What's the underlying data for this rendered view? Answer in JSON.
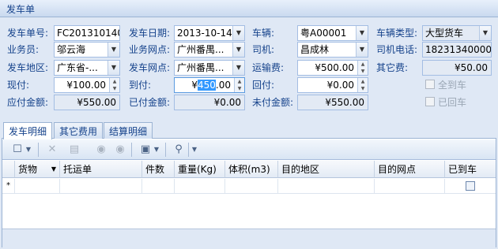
{
  "title": "发车单",
  "form": {
    "dispatch_no": {
      "label": "发车单号:",
      "value": "FC201310140"
    },
    "dispatch_date": {
      "label": "发车日期:",
      "value": "2013-10-14"
    },
    "vehicle": {
      "label": "车辆:",
      "value": "粤A00001"
    },
    "vehicle_type": {
      "label": "车辆类型:",
      "value": "大型货车"
    },
    "salesman": {
      "label": "业务员:",
      "value": "邬云海"
    },
    "dispatch_site": {
      "label": "业务网点:",
      "value": "广州番禺..."
    },
    "driver": {
      "label": "司机:",
      "value": "昌成林"
    },
    "driver_phone": {
      "label": "司机电话:",
      "value": "18231340000"
    },
    "origin_area": {
      "label": "发车地区:",
      "value": "广东省-..."
    },
    "origin_site": {
      "label": "发车网点:",
      "value": "广州番禺..."
    },
    "freight": {
      "label": "运输费:",
      "value": "¥500.00"
    },
    "other_fee": {
      "label": "其它费:",
      "value": "¥50.00"
    },
    "cash_pay": {
      "label": "现付:",
      "value": "¥100.00"
    },
    "arrival_pay": {
      "label": "到付:",
      "value_prefix": "¥",
      "value_sel": "450",
      "value_suffix": ".00"
    },
    "return_pay": {
      "label": "回付:",
      "value": "¥0.00"
    },
    "arrived": {
      "label": "全到车"
    },
    "payable": {
      "label": "应付金额:",
      "value": "¥550.00"
    },
    "paid": {
      "label": "已付金额:",
      "value": "¥0.00"
    },
    "unpaid": {
      "label": "未付金额:",
      "value": "¥550.00"
    },
    "returned": {
      "label": "已回车"
    }
  },
  "tabs": [
    "发车明细",
    "其它费用",
    "结算明细"
  ],
  "grid": {
    "columns": [
      "货物",
      "托运单",
      "件数",
      "重量(Kg)",
      "体积(m3)",
      "目的地区",
      "目的网点",
      "已到车"
    ],
    "new_row_marker": "*"
  }
}
